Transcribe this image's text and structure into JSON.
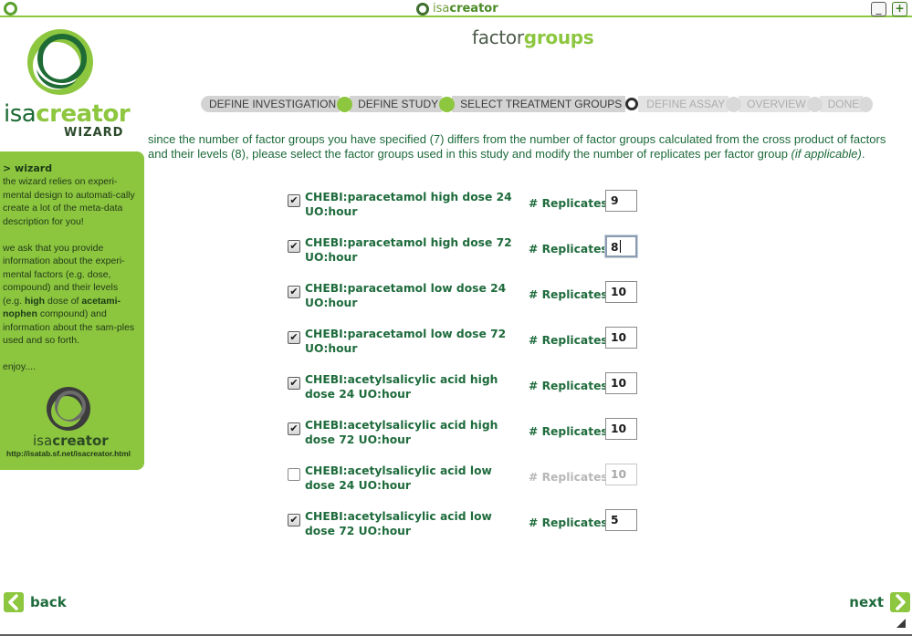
{
  "window": {
    "title_prefix": "isa",
    "title_suffix": "creator",
    "minimize_label": "_",
    "maximize_label": "+"
  },
  "logo": {
    "isa": "isa",
    "creator": "creator",
    "wizard": "WIZARD"
  },
  "page": {
    "heading_part1": "factor",
    "heading_part2": "groups"
  },
  "steps": [
    {
      "label": "DEFINE INVESTIGATION",
      "state": "done"
    },
    {
      "label": "DEFINE STUDY",
      "state": "done"
    },
    {
      "label": "SELECT TREATMENT GROUPS",
      "state": "current"
    },
    {
      "label": "DEFINE ASSAY",
      "state": "pending"
    },
    {
      "label": "OVERVIEW",
      "state": "pending"
    },
    {
      "label": "DONE",
      "state": "pending"
    }
  ],
  "intro": {
    "text": "since the number of factor groups you have specified (7) differs from the number of factor groups calculated from the cross product of factors and their levels (8), please select the factor groups used in this study and modify the number of replicates per factor group ",
    "note": "(if applicable)",
    "end": "."
  },
  "sidebar": {
    "title": "> wizard",
    "p1": "the wizard relies on experi-mental design to automati-cally create a lot of the meta-data description for you!",
    "p2_a": "we ask that you provide information about the experi-mental factors (e.g. dose, compound) and their levels (e.g. ",
    "p2_b": "high",
    "p2_c": " dose of ",
    "p2_d": "acetami-nophen",
    "p2_e": " compound) and information about the sam-ples used and so forth.",
    "p3": "enjoy....",
    "logo_isa": "isa",
    "logo_creator": "creator",
    "url": "http://isatab.sf.net/isacreator.html"
  },
  "replicates_label": "# Replicates",
  "factor_groups": [
    {
      "name": "CHEBI:paracetamol high dose 24 UO:hour",
      "checked": true,
      "replicates": "9",
      "focused": false
    },
    {
      "name": "CHEBI:paracetamol high dose 72 UO:hour",
      "checked": true,
      "replicates": "8",
      "focused": true
    },
    {
      "name": "CHEBI:paracetamol low dose 24 UO:hour",
      "checked": true,
      "replicates": "10",
      "focused": false
    },
    {
      "name": "CHEBI:paracetamol low dose 72 UO:hour",
      "checked": true,
      "replicates": "10",
      "focused": false
    },
    {
      "name": "CHEBI:acetylsalicylic acid high dose 24 UO:hour",
      "checked": true,
      "replicates": "10",
      "focused": false
    },
    {
      "name": "CHEBI:acetylsalicylic acid high dose 72 UO:hour",
      "checked": true,
      "replicates": "10",
      "focused": false
    },
    {
      "name": "CHEBI:acetylsalicylic acid low dose 24 UO:hour",
      "checked": false,
      "replicates": "10",
      "focused": false
    },
    {
      "name": "CHEBI:acetylsalicylic acid low dose 72 UO:hour",
      "checked": true,
      "replicates": "5",
      "focused": false
    }
  ],
  "nav": {
    "back": "back",
    "next": "next"
  },
  "colors": {
    "accent_green": "#8dc63f",
    "dark_green": "#1e6b3c",
    "step_grey": "#d3d3d3"
  }
}
